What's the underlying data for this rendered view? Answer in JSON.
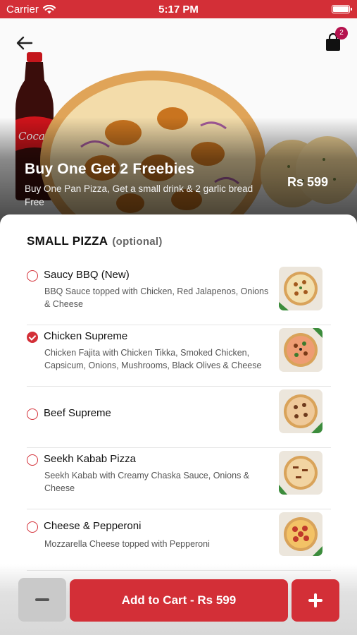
{
  "status_bar": {
    "carrier": "Carrier",
    "time": "5:17 PM"
  },
  "header": {
    "cart_count": "2"
  },
  "deal": {
    "title": "Buy One Get 2 Freebies",
    "description": "Buy One Pan Pizza, Get a small drink & 2 garlic bread Free",
    "price": "Rs 599"
  },
  "section": {
    "title": "SMALL PIZZA",
    "optional_label": "(optional)"
  },
  "items": [
    {
      "name": "Saucy BBQ (New)",
      "description": "BBQ Sauce topped with Chicken, Red Jalapenos, Onions & Cheese",
      "selected": false
    },
    {
      "name": "Chicken Supreme",
      "description": "Chicken Fajita with Chicken Tikka, Smoked Chicken, Capsicum, Onions, Mushrooms, Black Olives & Cheese",
      "selected": true
    },
    {
      "name": "Beef Supreme",
      "description": "",
      "selected": false
    },
    {
      "name": "Seekh Kabab Pizza",
      "description": "Seekh Kabab with Creamy Chaska Sauce, Onions & Cheese",
      "selected": false
    },
    {
      "name": "Cheese & Pepperoni",
      "description": "Mozzarella Cheese topped with Pepperoni",
      "selected": false
    }
  ],
  "footer": {
    "add_to_cart_label": "Add to Cart - Rs 599"
  },
  "colors": {
    "accent": "#d32f37",
    "badge": "#b5124e",
    "quantity_button": "#c9c9c9"
  }
}
